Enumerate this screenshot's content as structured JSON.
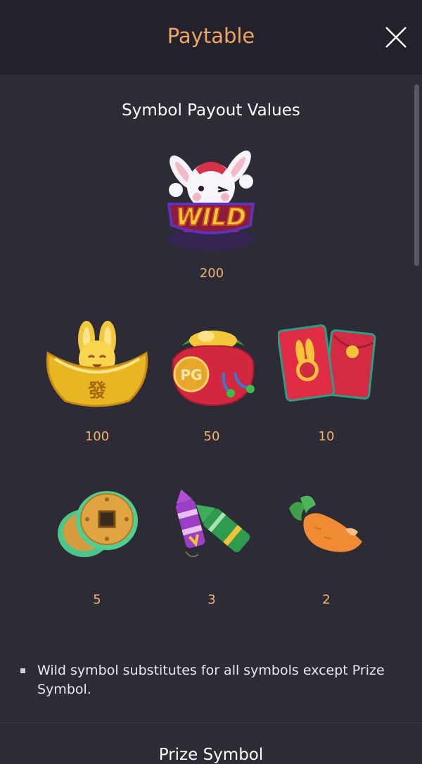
{
  "header": {
    "title": "Paytable",
    "close_icon": "close-icon"
  },
  "section": {
    "title": "Symbol Payout Values"
  },
  "symbols": [
    {
      "name": "rabbit-wild",
      "label": "WILD",
      "payout": "200"
    },
    {
      "name": "gold-ingot",
      "payout": "100"
    },
    {
      "name": "money-bag",
      "label": "PG",
      "payout": "50"
    },
    {
      "name": "red-envelopes",
      "payout": "10"
    },
    {
      "name": "coins",
      "payout": "5"
    },
    {
      "name": "firecrackers",
      "payout": "3"
    },
    {
      "name": "carrot",
      "payout": "2"
    }
  ],
  "notes": [
    "Wild symbol substitutes for all symbols except Prize Symbol."
  ],
  "next_section": {
    "title": "Prize Symbol"
  },
  "colors": {
    "title": "#f0a461",
    "payout": "#f0b56e",
    "background": "#2c2b36",
    "header_bg": "#23222c"
  }
}
